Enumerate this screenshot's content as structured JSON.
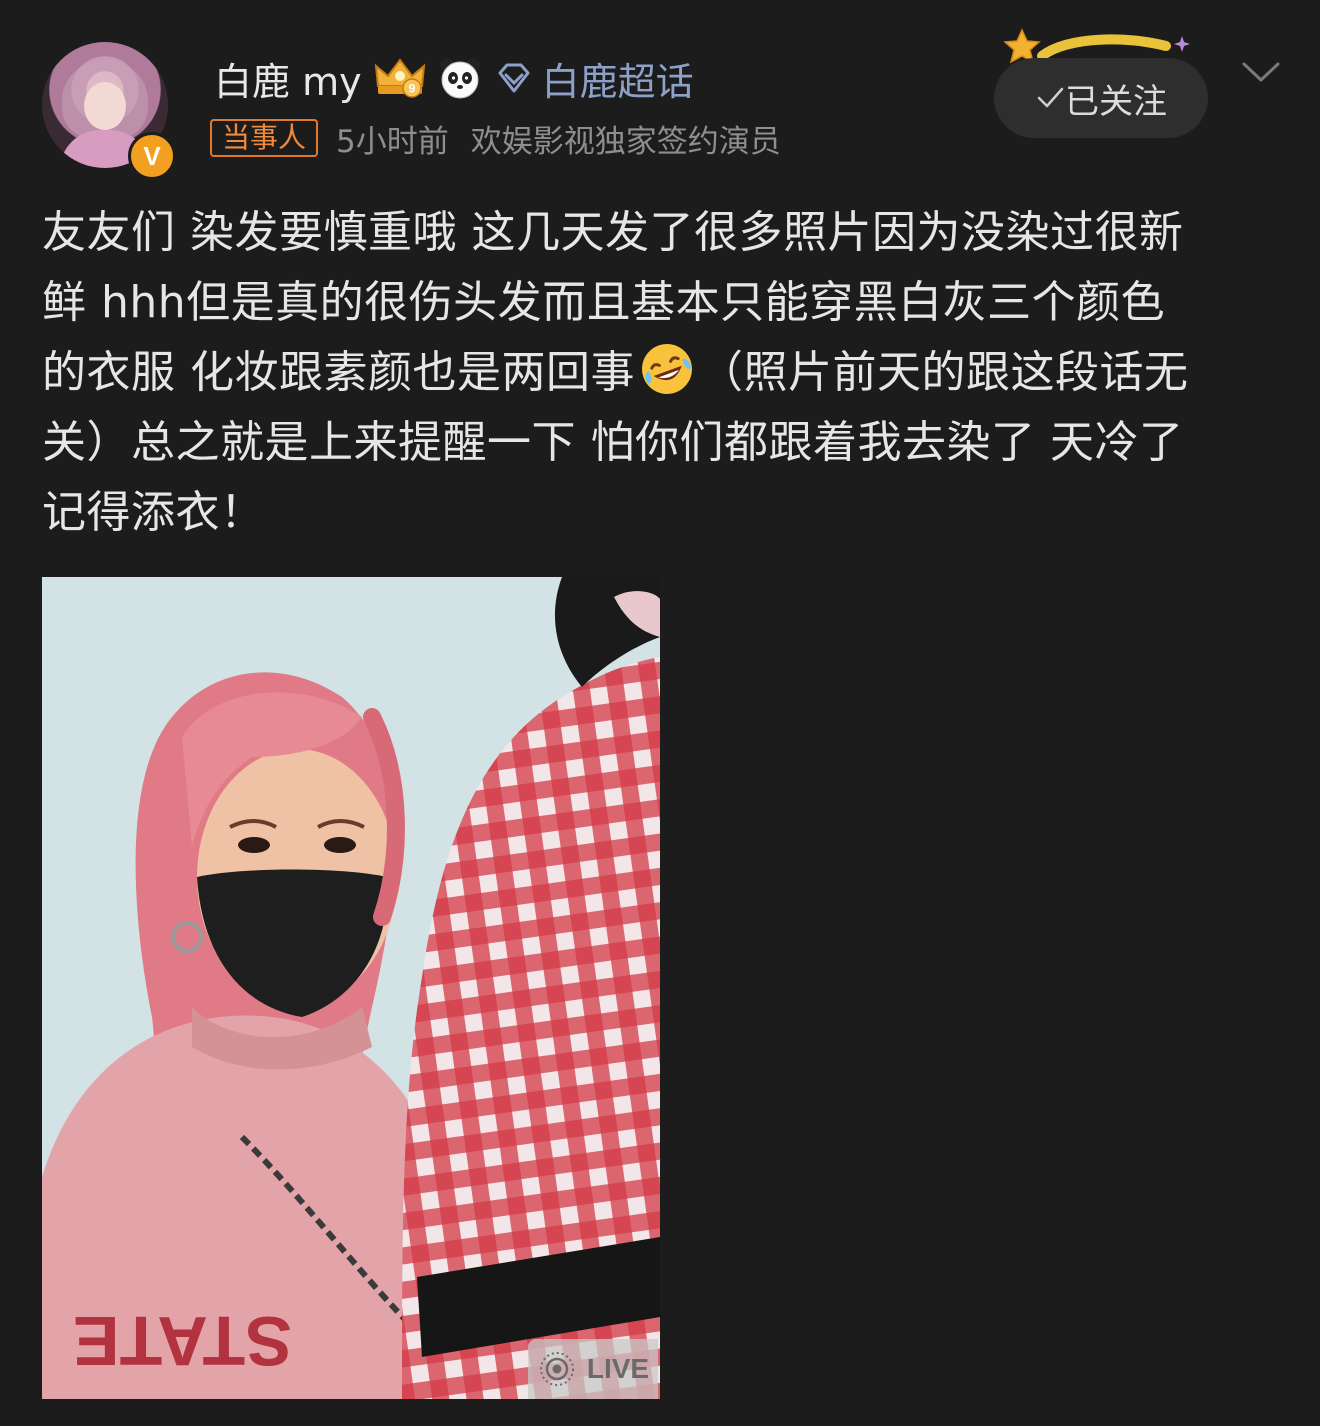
{
  "user": {
    "name": "白鹿 my",
    "crown_level": "9",
    "super_topic_label": "白鹿超话",
    "verified_mark": "V",
    "role_badge": "当事人",
    "time": "5小时前",
    "description": "欢娱影视独家签约演员"
  },
  "follow_button": {
    "label": "已关注"
  },
  "post": {
    "lines": [
      "友友们 染发要慎重哦 这几天发了很多照片因为没染过很新",
      "鲜 hhh但是真的很伤头发而且基本只能穿黑白灰三个颜色",
      "的衣服 化妆跟素颜也是两回事",
      "（照片前天的跟这段话无",
      "关）总之就是上来提醒一下 怕你们都跟着我去染了 天冷了",
      "记得添衣！"
    ]
  },
  "photo": {
    "live_label": "LIVE",
    "sweater_text": "STATE"
  },
  "colors": {
    "background": "#1c1c1c",
    "super_topic": "#8da0c7",
    "badge_orange": "#f08a3a",
    "verified": "#f3a020",
    "hair_pink": "#e07a86",
    "plaid_red": "#d23a48"
  },
  "icons": [
    "avatar",
    "verified-badge-icon",
    "crown-level-icon",
    "panda-icon",
    "diamond-icon",
    "star-decoration-icon",
    "check-icon",
    "chevron-down-icon",
    "laughing-emoji-icon",
    "live-photo-icon"
  ]
}
